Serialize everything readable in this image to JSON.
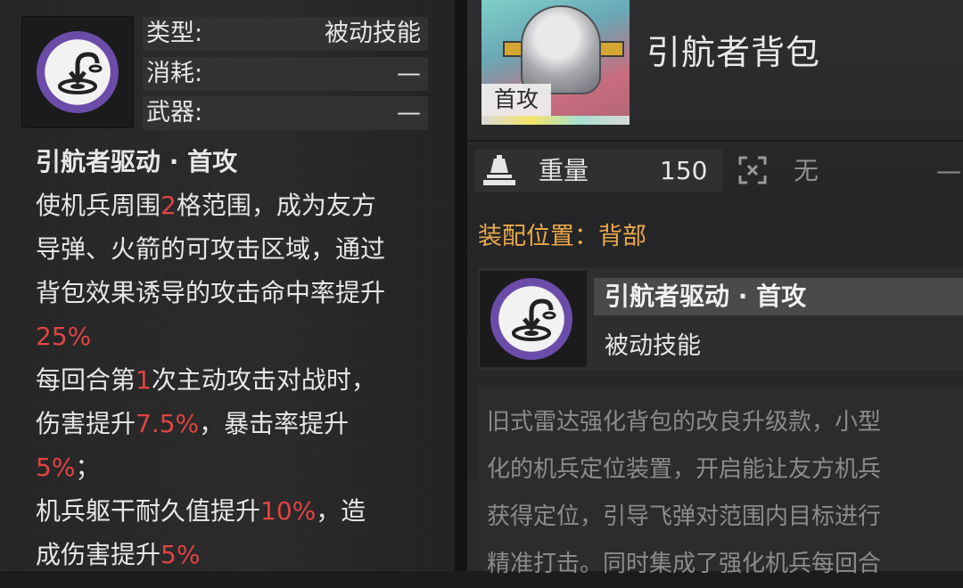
{
  "left_panel": {
    "stats": [
      {
        "key": "类型:",
        "value": "被动技能"
      },
      {
        "key": "消耗:",
        "value": "—"
      },
      {
        "key": "武器:",
        "value": "—"
      }
    ],
    "skill_title": "引航者驱动 · 首攻",
    "desc_lines": [
      [
        {
          "t": "使机兵周围"
        },
        {
          "t": "2",
          "hl": true
        },
        {
          "t": "格范围，成为友方"
        }
      ],
      [
        {
          "t": "导弹、火箭的可攻击区域，通过"
        }
      ],
      [
        {
          "t": "背包效果诱导的攻击命中率提升"
        }
      ],
      [
        {
          "t": "25%",
          "hl": true
        }
      ],
      [
        {
          "t": "每回合第"
        },
        {
          "t": "1",
          "hl": true
        },
        {
          "t": "次主动攻击对战时，"
        }
      ],
      [
        {
          "t": "伤害提升"
        },
        {
          "t": "7.5%",
          "hl": true
        },
        {
          "t": "，暴击率提升"
        }
      ],
      [
        {
          "t": "5%",
          "hl": true
        },
        {
          "t": "；"
        }
      ],
      [
        {
          "t": "机兵躯干耐久值提升"
        },
        {
          "t": "10%",
          "hl": true
        },
        {
          "t": "，造"
        }
      ],
      [
        {
          "t": "成伤害提升"
        },
        {
          "t": "5%",
          "hl": true
        }
      ]
    ]
  },
  "item": {
    "name": "引航者背包",
    "thumb_tag": "首攻",
    "weight_label": "重量",
    "weight_value": "150",
    "ammo_value": "无",
    "ammo_dash": "—",
    "equip_position": "装配位置：背部"
  },
  "skill_card": {
    "name": "引航者驱动 · 首攻",
    "type": "被动技能"
  },
  "description": [
    "旧式雷达强化背包的改良升级款，小型",
    "化的机兵定位装置，开启能让友方机兵",
    "获得定位，引导飞弹对范围内目标进行",
    "精准打击。同时集成了强化机兵每回合"
  ],
  "colors": {
    "highlight": "#e04444",
    "equip_label": "#e9a94a",
    "ring": "#6b4ca8"
  },
  "icons": [
    "pilot-drive-skill-icon",
    "weight-icon",
    "ammo-crosshair-icon"
  ]
}
